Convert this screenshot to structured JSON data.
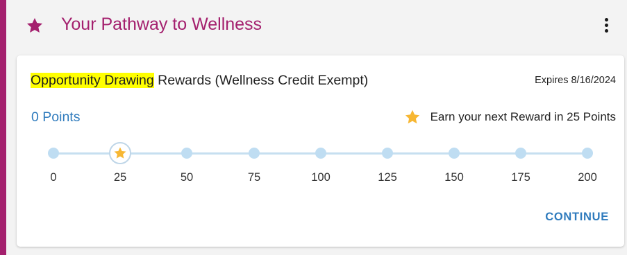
{
  "header": {
    "title": "Your Pathway to Wellness",
    "icon": "star-icon",
    "menu_icon": "more-vertical-icon"
  },
  "card": {
    "title_highlight": "Opportunity Drawing",
    "title_rest": " Rewards (Wellness Credit Exempt)",
    "expires": "Expires 8/16/2024",
    "points": "0 Points",
    "next_reward": "Earn your next Reward in 25 Points",
    "continue_label": "CONTINUE"
  },
  "progress": {
    "current_points": 0,
    "next_reward_at": 25,
    "ticks": [
      "0",
      "25",
      "50",
      "75",
      "100",
      "125",
      "150",
      "175",
      "200"
    ]
  },
  "colors": {
    "accent": "#a4206e",
    "link": "#2f7bbd",
    "star": "#f7b733",
    "highlight": "#ffff00",
    "track": "#c6dff0"
  }
}
